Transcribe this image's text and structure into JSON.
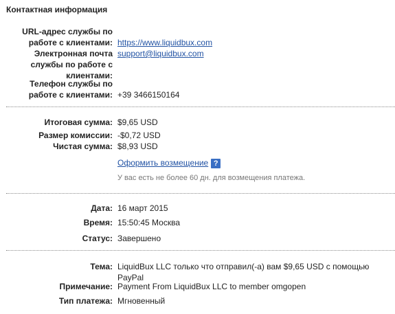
{
  "contact": {
    "title": "Контактная информация",
    "url_label_1": "URL-адрес службы по",
    "url_label_2": "работе с клиентами:",
    "url_value": "https://www.liquidbux.com",
    "email_label_1": "Электронная почта",
    "email_label_2": "службы по работе с",
    "email_label_3": "клиентами:",
    "email_value": "support@liquidbux.com",
    "phone_label_1": "Телефон службы по",
    "phone_label_2": "работе с клиентами:",
    "phone_value": "+39 3466150164"
  },
  "amounts": {
    "total_label": "Итоговая сумма:",
    "total_value": "$9,65 USD",
    "fee_label": "Размер комиссии:",
    "fee_value": "-$0,72 USD",
    "net_label": "Чистая сумма:",
    "net_value": "$8,93 USD",
    "refund_link": "Оформить возмещение",
    "help_glyph": "?",
    "refund_note": "У вас есть не более 60 дн. для возмещения платежа."
  },
  "details": {
    "date_label": "Дата:",
    "date_value": "16 март 2015",
    "time_label": "Время:",
    "time_value": "15:50:45 Москва",
    "status_label": "Статус:",
    "status_value": "Завершено"
  },
  "message": {
    "subject_label": "Тема:",
    "subject_line_1": "LiquidBux LLC только что отправил(-а) вам $9,65 USD с помощью",
    "subject_line_2": "PayPal",
    "note_label": "Примечание:",
    "note_value": "Payment From LiquidBux LLC to member omgopen",
    "type_label": "Тип платежа:",
    "type_value": "Мгновенный"
  },
  "colors": {
    "link": "#2152a3",
    "help_icon": "#3a6fc4",
    "muted": "#777777"
  }
}
